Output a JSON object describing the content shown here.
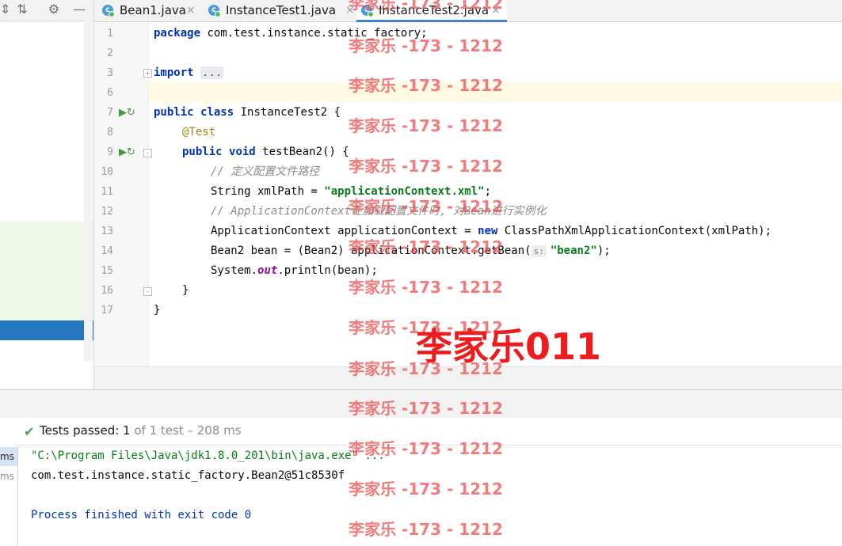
{
  "tabs": [
    {
      "label": "Bean1.java",
      "close": "×"
    },
    {
      "label": "InstanceTest1.java",
      "close": "×"
    },
    {
      "label": "InstanceTest2.java",
      "close": "×"
    }
  ],
  "tab_icon_letter": "c",
  "line_numbers": [
    "1",
    "2",
    "3",
    "6",
    "7",
    "8",
    "9",
    "10",
    "11",
    "12",
    "13",
    "14",
    "15",
    "16",
    "17"
  ],
  "code": {
    "l1_kw": "package",
    "l1_rest": " com.test.instance.static_factory;",
    "l3_kw": "import",
    "l3_fold": "...",
    "l7_kw1": "public",
    "l7_kw2": "class",
    "l7_rest": " InstanceTest2 {",
    "l8_ann": "@Test",
    "l9_kw1": "public",
    "l9_kw2": "void",
    "l9_rest": " testBean2() {",
    "l10_cmt": "// 定义配置文件路径",
    "l11_pre": "String xmlPath = ",
    "l11_str": "\"applicationContext.xml\"",
    "l11_post": ";",
    "l12_cmt": "// ApplicationContext在加载配置文件时, 对Bean进行实例化",
    "l13_pre": "ApplicationContext applicationContext = ",
    "l13_kw": "new",
    "l13_post": " ClassPathXmlApplicationContext(xmlPath);",
    "l14_pre": "Bean2 bean = (Bean2) applicationContext.getBean(",
    "l14_hint": "s:",
    "l14_str": "\"bean2\"",
    "l14_post": ");",
    "l15_pre": "System.",
    "l15_stat": "out",
    "l15_post": ".println(bean);",
    "l16": "}",
    "l17": "}"
  },
  "status": {
    "bold": "Tests passed: ",
    "count": "1",
    "muted": " of 1 test – 208 ms"
  },
  "tree_ms": [
    "ms",
    "ms"
  ],
  "console": {
    "line1": "\"C:\\Program Files\\Java\\jdk1.8.0_201\\bin\\java.exe\" ...",
    "line2": "com.test.instance.static_factory.Bean2@51c8530f",
    "line3": "Process finished with exit code 0"
  },
  "watermark_small": "李家乐 -173 - 1212",
  "watermark_big": "李家乐011",
  "colors": {
    "keyword": "#0033b3",
    "string": "#067d17",
    "comment": "#8c8c8c",
    "annotation": "#9e880d",
    "console_cmd": "#067d17",
    "console_exit": "#0033b3",
    "pass": "#499c54"
  }
}
